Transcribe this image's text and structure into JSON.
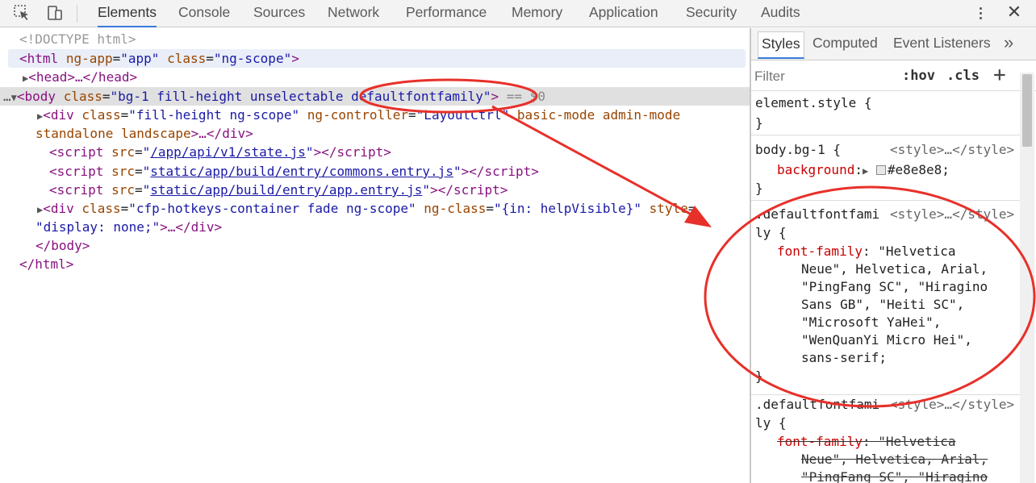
{
  "toolbar": {
    "tabs": [
      "Elements",
      "Console",
      "Sources",
      "Network",
      "Performance",
      "Memory",
      "Application",
      "Security",
      "Audits"
    ],
    "active_tab": "Elements",
    "close_label": "✕"
  },
  "elements": {
    "doctype": "<!DOCTYPE html>",
    "html_tag": "html",
    "html_attr1": "ng-app",
    "html_val1": "\"app\"",
    "html_attr2": "class",
    "html_val2": "\"ng-scope\"",
    "head_collapsed": "<head>…</head>",
    "body_tag": "body",
    "body_attr": "class",
    "body_val": "\"bg-1 fill-height unselectable defaultfontfamily\"",
    "body_marker": " == $0",
    "div1_tag": "div",
    "div1_a1": "class",
    "div1_v1": "\"fill-height ng-scope\"",
    "div1_a2": "ng-controller",
    "div1_v2": "\"LayoutCtrl\"",
    "div1_a3": "basic-mode admin-mode",
    "div1_a4": "standalone landscape",
    "div1_tail": ">…</div>",
    "script1_src": "/app/api/v1/state.js",
    "script2_src": "static/app/build/entry/commons.entry.js",
    "script3_src": "static/app/build/entry/app.entry.js",
    "div2_tag": "div",
    "div2_a1": "class",
    "div2_v1": "\"cfp-hotkeys-container fade ng-scope\"",
    "div2_a2": "ng-class",
    "div2_v2": "\"{in: helpVisible}\"",
    "div2_a3": "style",
    "div2_v3": "\"display: none;\"",
    "div2_tail": ">…</div>",
    "body_close": "</body>",
    "html_close": "</html>"
  },
  "styles_pane": {
    "tabs": [
      "Styles",
      "Computed",
      "Event Listeners"
    ],
    "more": "»",
    "filter_placeholder": "Filter",
    "hov": ":hov",
    "cls": ".cls",
    "plus": "+",
    "rules": {
      "element_style": "element.style {",
      "close": "}",
      "bg_selector": "body.bg-1 {",
      "bg_source": "<style>…</style>",
      "bg_prop": "background",
      "bg_value": "#e8e8e8;",
      "ff_selector_1": ".defaultfontfami",
      "ff_selector_2": "ly {",
      "ff_source": "<style>…</style>",
      "ff_prop": "font-family",
      "ff_lines": [
        "\"Helvetica",
        "Neue\", Helvetica, Arial,",
        "\"PingFang SC\", \"Hiragino",
        "Sans GB\", \"Heiti SC\",",
        "\"Microsoft YaHei\",",
        "\"WenQuanYi Micro Hei\",",
        "sans-serif;"
      ],
      "ff2_selector_1": ".defaultfontfami",
      "ff2_selector_2": "ly {",
      "ff2_source": "<style>…</style>",
      "ff2_prop": "font-family",
      "ff2_lines": [
        "\"Helvetica",
        "Neue\", Helvetica, Arial,",
        "\"PingFang SC\", \"Hiragino"
      ]
    }
  },
  "annotation": {
    "color": "#e8302a"
  }
}
